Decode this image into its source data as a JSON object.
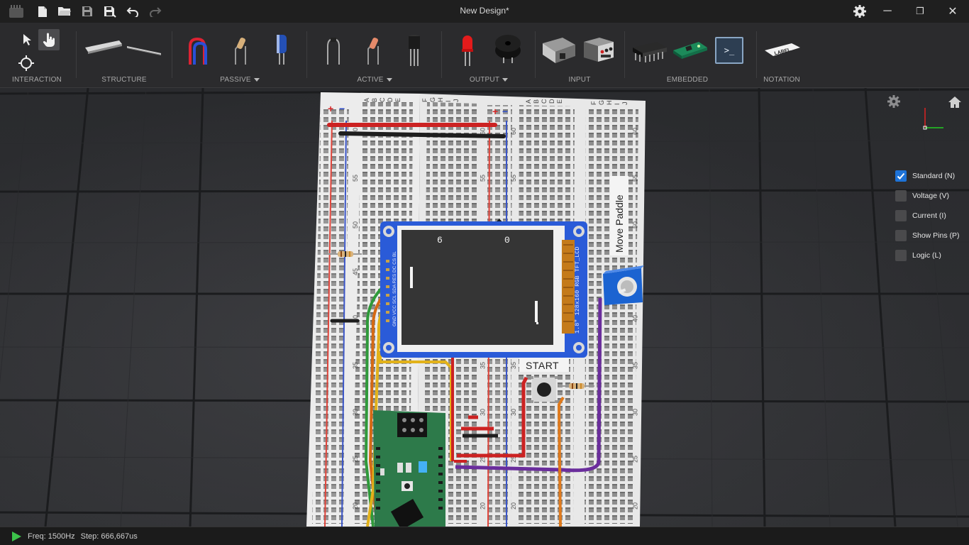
{
  "window": {
    "title": "New Design*",
    "minimize": "─",
    "restore": "❐",
    "close": "✕"
  },
  "toolbar": {
    "groups": {
      "interaction": "INTERACTION",
      "structure": "STRUCTURE",
      "passive": "PASSIVE",
      "active": "ACTIVE",
      "output": "OUTPUT",
      "input": "INPUT",
      "embedded": "EMBEDDED",
      "notation": "NOTATION"
    },
    "label_tag": "LABEL",
    "terminal_prompt": ">_"
  },
  "board": {
    "rows_left": [
      "A",
      "B",
      "C",
      "D",
      "E"
    ],
    "rows_mid": [
      "F",
      "G",
      "H",
      "I",
      "J"
    ],
    "rows_right": [
      "A",
      "B",
      "C",
      "D",
      "E"
    ],
    "rows_far": [
      "F",
      "G",
      "H",
      "I",
      "J"
    ],
    "row_numbers": [
      "60",
      "55",
      "50",
      "45",
      "40",
      "35",
      "30",
      "25",
      "20"
    ],
    "rail_plus": "+",
    "rail_minus": "−",
    "lcd": {
      "score_left": "6",
      "score_right": "0",
      "module_label": "1.8\" 128x160 RGB TFT_LCD",
      "pin_labels": "GND VCC SCL SDA RES DC CS BL"
    },
    "start_label": "START",
    "paddle_label": "Move Paddle"
  },
  "views": [
    {
      "label": "Standard (N)",
      "checked": true
    },
    {
      "label": "Voltage (V)",
      "checked": false
    },
    {
      "label": "Current (I)",
      "checked": false
    },
    {
      "label": "Show Pins (P)",
      "checked": false
    },
    {
      "label": "Logic (L)",
      "checked": false
    }
  ],
  "status": {
    "freq": "Freq: 1500Hz",
    "step": "Step: 666,667us"
  },
  "colors": {
    "accent": "#1e73d8",
    "wire_red": "#d42a2a",
    "wire_black": "#222222",
    "wire_yellow": "#e2b21a",
    "wire_orange": "#e07a1c",
    "wire_purple": "#6a2d9c",
    "wire_green": "#2f9a3a",
    "lcd_pcb": "#2a5bd8",
    "play_green": "#3cc24a"
  }
}
